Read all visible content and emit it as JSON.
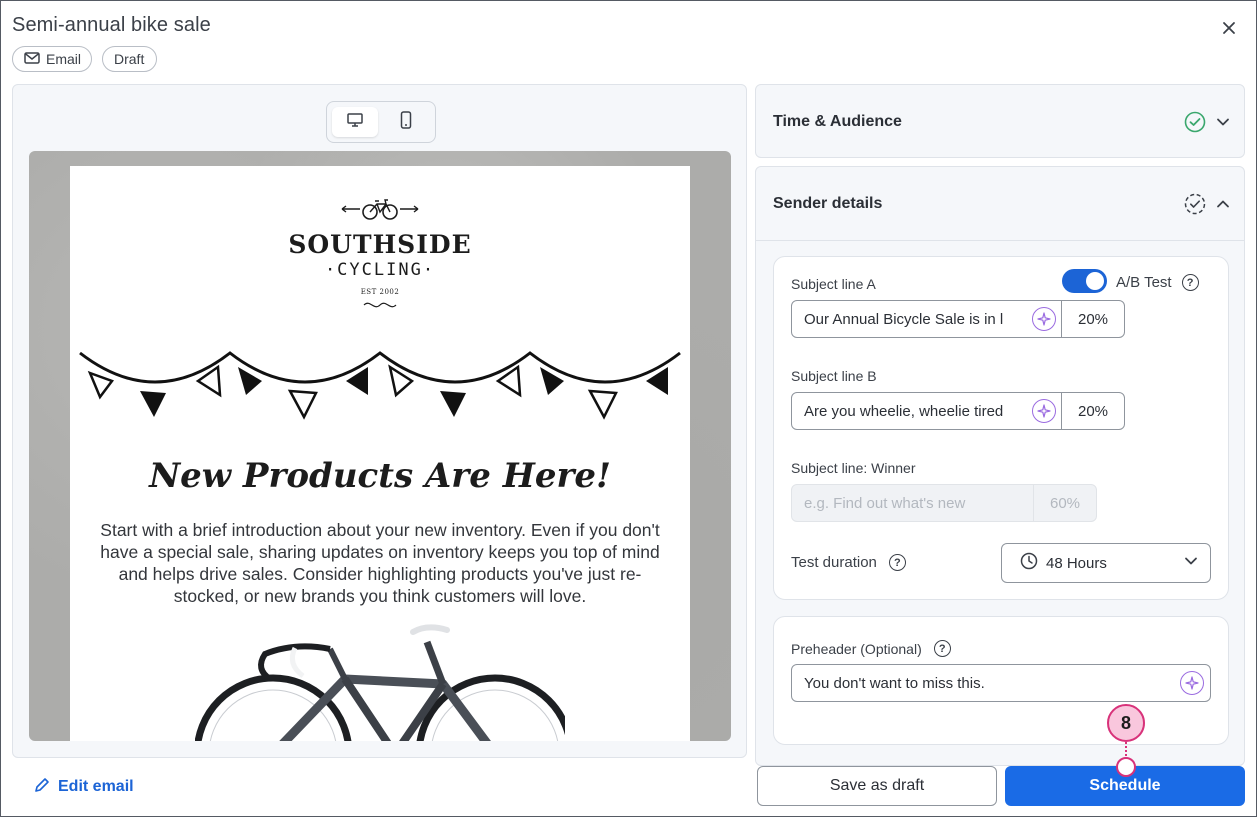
{
  "header": {
    "title": "Semi-annual bike sale",
    "tags": [
      "Email",
      "Draft"
    ]
  },
  "preview": {
    "logo_main": "SOUTHSIDE",
    "logo_sub": "·CYCLING·",
    "logo_est": "EST 2002",
    "headline": "New Products Are Here!",
    "body": "Start with a brief introduction about your new inventory. Even if you don't have a special sale, sharing updates on inventory keeps you top of mind and helps drive sales. Consider highlighting products you've just re-stocked, or new brands you think customers will love."
  },
  "edit_email_label": "Edit email",
  "sections": {
    "time_audience": "Time & Audience",
    "sender_details": "Sender details"
  },
  "ab": {
    "subject_a_label": "Subject line A",
    "subject_a_value": "Our Annual Bicycle Sale is in l",
    "subject_a_pct": "20%",
    "ab_test_label": "A/B Test",
    "ab_test_on": true,
    "subject_b_label": "Subject line B",
    "subject_b_value": "Are you wheelie, wheelie tired",
    "subject_b_pct": "20%",
    "winner_label": "Subject line: Winner",
    "winner_placeholder": "e.g. Find out what's new",
    "winner_pct": "60%",
    "duration_label": "Test duration",
    "duration_value": "48 Hours"
  },
  "preheader": {
    "label": "Preheader (Optional)",
    "value": "You don't want to miss this."
  },
  "buttons": {
    "save_draft": "Save as draft",
    "schedule": "Schedule"
  },
  "callout": {
    "number": "8"
  },
  "colors": {
    "accent": "#1a6be6",
    "callout": "#d8327a",
    "check": "#3aa76d",
    "ai": "#9a6be0"
  }
}
